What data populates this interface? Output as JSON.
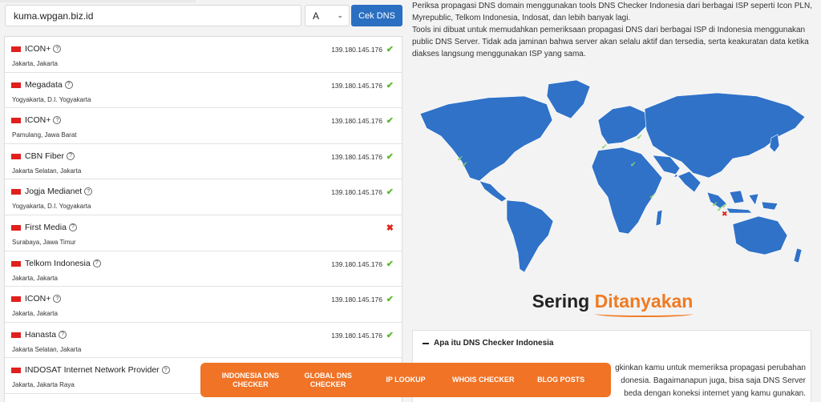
{
  "search": {
    "domain": "kuma.wpgan.biz.id",
    "record_type": "A",
    "button_label": "Cek DNS"
  },
  "results": [
    {
      "isp": "ICON+",
      "location": "Jakarta, Jakarta",
      "ip": "139.180.145.176",
      "status": "ok"
    },
    {
      "isp": "Megadata",
      "location": "Yogyakarta, D.I. Yogyakarta",
      "ip": "139.180.145.176",
      "status": "ok"
    },
    {
      "isp": "ICON+",
      "location": "Pamulang, Jawa Barat",
      "ip": "139.180.145.176",
      "status": "ok"
    },
    {
      "isp": "CBN Fiber",
      "location": "Jakarta Selatan, Jakarta",
      "ip": "139.180.145.176",
      "status": "ok"
    },
    {
      "isp": "Jogja Medianet",
      "location": "Yogyakarta, D.I. Yogyakarta",
      "ip": "139.180.145.176",
      "status": "ok"
    },
    {
      "isp": "First Media",
      "location": "Surabaya, Jawa Timur",
      "ip": "",
      "status": "fail"
    },
    {
      "isp": "Telkom Indonesia",
      "location": "Jakarta, Jakarta",
      "ip": "139.180.145.176",
      "status": "ok"
    },
    {
      "isp": "ICON+",
      "location": "Jakarta, Jakarta",
      "ip": "139.180.145.176",
      "status": "ok"
    },
    {
      "isp": "Hanasta",
      "location": "Jakarta Selatan, Jakarta",
      "ip": "139.180.145.176",
      "status": "ok"
    },
    {
      "isp": "INDOSAT Internet Network Provider",
      "location": "Jakarta, Jakarta Raya",
      "ip": "",
      "status": "none"
    }
  ],
  "status_icons": {
    "ok": "✔",
    "fail": "✖",
    "none": ""
  },
  "description": {
    "p1": "Periksa propagasi DNS domain menggunakan tools DNS Checker Indonesia dari berbagai ISP seperti Icon PLN, Myrepublic, Telkom Indonesia, Indosat, dan lebih banyak lagi.",
    "p2": "Tools ini dibuat untuk memudahkan pemeriksaan propagasi DNS dari berbagai ISP di Indonesia menggunakan public DNS Server. Tidak ada jaminan bahwa server akan selalu aktif dan tersedia, serta keakuratan data ketika diakses langsung menggunakan ISP yang sama."
  },
  "faq": {
    "title_part1": "Sering ",
    "title_part2": "Ditanyakan",
    "question": "Apa itu DNS Checker Indonesia",
    "answer_line1": "gkinkan kamu untuk memeriksa propagasi perubahan",
    "answer_line2": "donesia. Bagaimanapun juga,  bisa saja DNS Server",
    "answer_line3": "beda dengan koneksi internet yang kamu gunakan."
  },
  "bottom_nav": [
    {
      "label": "INDONESIA DNS CHECKER"
    },
    {
      "label": "GLOBAL DNS CHECKER"
    },
    {
      "label": "IP LOOKUP"
    },
    {
      "label": "WHOIS CHECKER"
    },
    {
      "label": "BLOG POSTS"
    }
  ],
  "colors": {
    "primary_blue": "#2a6fc2",
    "map_blue": "#2f72c8",
    "accent_orange": "#f07326",
    "ok_green": "#5cb82e",
    "fail_red": "#e2231a"
  }
}
